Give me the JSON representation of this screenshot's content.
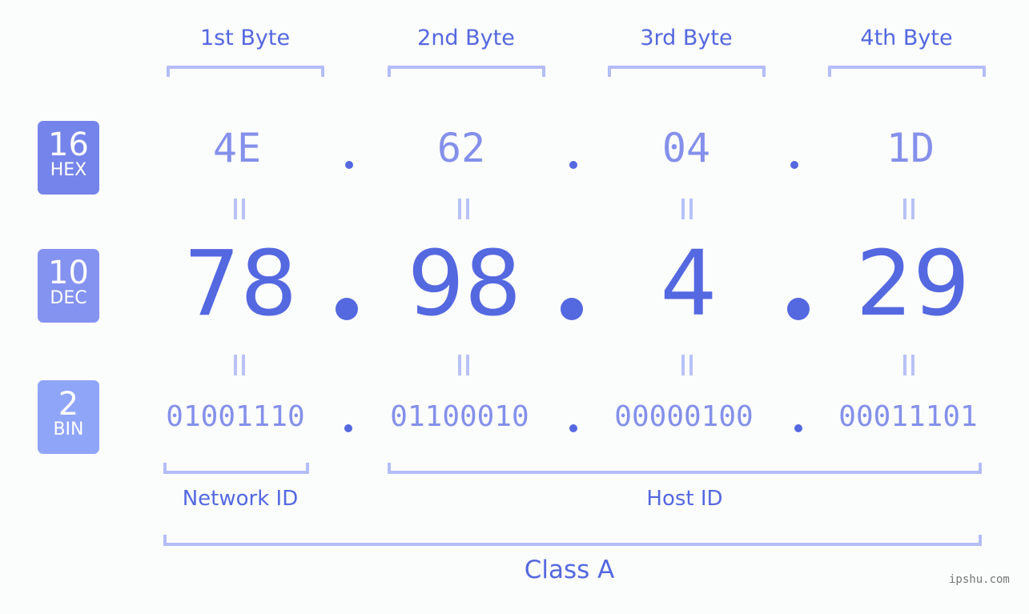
{
  "bytes": [
    {
      "label": "1st Byte",
      "hex": "4E",
      "dec": "78",
      "bin": "01001110"
    },
    {
      "label": "2nd Byte",
      "hex": "62",
      "dec": "98",
      "bin": "01100010"
    },
    {
      "label": "3rd Byte",
      "hex": "04",
      "dec": "4",
      "bin": "00000100"
    },
    {
      "label": "4th Byte",
      "hex": "1D",
      "dec": "29",
      "bin": "00011101"
    }
  ],
  "badges": {
    "hex": {
      "num": "16",
      "unit": "HEX",
      "color": "#7584ea"
    },
    "dec": {
      "num": "10",
      "unit": "DEC",
      "color": "#8492f0"
    },
    "bin": {
      "num": "2",
      "unit": "BIN",
      "color": "#8fa5f8"
    }
  },
  "segments": {
    "network": "Network ID",
    "host": "Host ID",
    "class": "Class A"
  },
  "watermark": "ipshu.com",
  "colors": {
    "primary": "#5468e0",
    "light": "#8490ea",
    "bracket": "#b4bdf7"
  }
}
